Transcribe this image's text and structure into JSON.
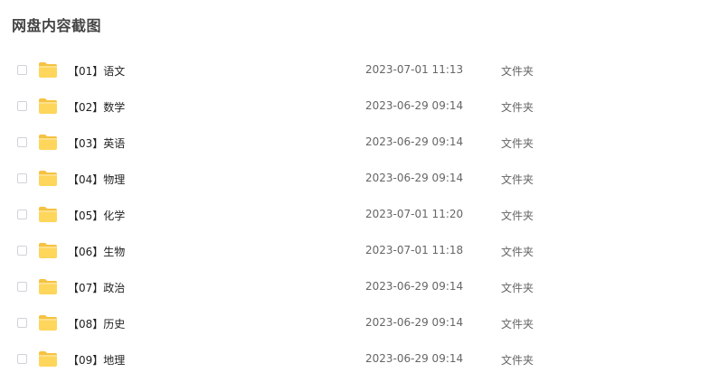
{
  "page": {
    "title": "网盘内容截图"
  },
  "icons": {
    "folder": "folder-icon",
    "checkbox": "checkbox"
  },
  "colors": {
    "folder_top": "#f7c948",
    "folder_body": "#ffd966"
  },
  "files": [
    {
      "name": "【01】语文",
      "time": "2023-07-01 11:13",
      "type": "文件夹"
    },
    {
      "name": "【02】数学",
      "time": "2023-06-29 09:14",
      "type": "文件夹"
    },
    {
      "name": "【03】英语",
      "time": "2023-06-29 09:14",
      "type": "文件夹"
    },
    {
      "name": "【04】物理",
      "time": "2023-06-29 09:14",
      "type": "文件夹"
    },
    {
      "name": "【05】化学",
      "time": "2023-07-01 11:20",
      "type": "文件夹"
    },
    {
      "name": "【06】生物",
      "time": "2023-07-01 11:18",
      "type": "文件夹"
    },
    {
      "name": "【07】政治",
      "time": "2023-06-29 09:14",
      "type": "文件夹"
    },
    {
      "name": "【08】历史",
      "time": "2023-06-29 09:14",
      "type": "文件夹"
    },
    {
      "name": "【09】地理",
      "time": "2023-06-29 09:14",
      "type": "文件夹"
    }
  ]
}
